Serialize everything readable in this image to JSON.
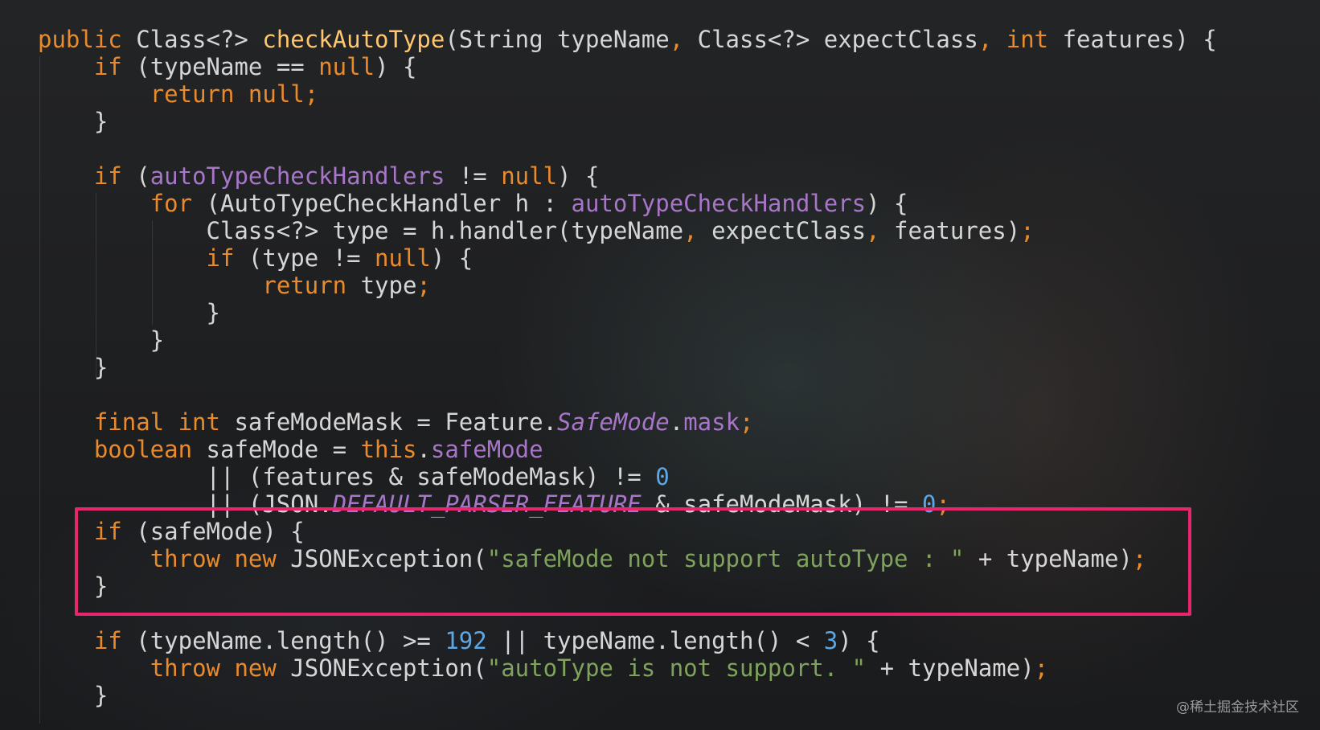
{
  "watermark": "@稀土掘金技术社区",
  "code_lines": [
    [
      {
        "t": "public ",
        "c": "kw"
      },
      {
        "t": "Class<?> ",
        "c": ""
      },
      {
        "t": "checkAutoType",
        "c": "fn"
      },
      {
        "t": "(String typeName",
        "c": ""
      },
      {
        "t": ", ",
        "c": "sep"
      },
      {
        "t": "Class<?> expectClass",
        "c": ""
      },
      {
        "t": ", ",
        "c": "sep"
      },
      {
        "t": "int ",
        "c": "kw"
      },
      {
        "t": "features) {",
        "c": ""
      }
    ],
    [
      {
        "t": "    ",
        "c": ""
      },
      {
        "t": "if ",
        "c": "kw"
      },
      {
        "t": "(typeName == ",
        "c": ""
      },
      {
        "t": "null",
        "c": "kw"
      },
      {
        "t": ") {",
        "c": ""
      }
    ],
    [
      {
        "t": "        ",
        "c": ""
      },
      {
        "t": "return null;",
        "c": "kw"
      }
    ],
    [
      {
        "t": "    }",
        "c": ""
      }
    ],
    [],
    [
      {
        "t": "    ",
        "c": ""
      },
      {
        "t": "if ",
        "c": "kw"
      },
      {
        "t": "(",
        "c": ""
      },
      {
        "t": "autoTypeCheckHandlers",
        "c": "fld"
      },
      {
        "t": " != ",
        "c": ""
      },
      {
        "t": "null",
        "c": "kw"
      },
      {
        "t": ") {",
        "c": ""
      }
    ],
    [
      {
        "t": "        ",
        "c": ""
      },
      {
        "t": "for ",
        "c": "kw"
      },
      {
        "t": "(AutoTypeCheckHandler h : ",
        "c": ""
      },
      {
        "t": "autoTypeCheckHandlers",
        "c": "fld"
      },
      {
        "t": ") {",
        "c": ""
      }
    ],
    [
      {
        "t": "            Class<?> type = h.handler(typeName",
        "c": ""
      },
      {
        "t": ", ",
        "c": "sep"
      },
      {
        "t": "expectClass",
        "c": ""
      },
      {
        "t": ", ",
        "c": "sep"
      },
      {
        "t": "features)",
        "c": ""
      },
      {
        "t": ";",
        "c": "sep"
      }
    ],
    [
      {
        "t": "            ",
        "c": ""
      },
      {
        "t": "if ",
        "c": "kw"
      },
      {
        "t": "(type != ",
        "c": ""
      },
      {
        "t": "null",
        "c": "kw"
      },
      {
        "t": ") {",
        "c": ""
      }
    ],
    [
      {
        "t": "                ",
        "c": ""
      },
      {
        "t": "return ",
        "c": "kw"
      },
      {
        "t": "type",
        "c": ""
      },
      {
        "t": ";",
        "c": "sep"
      }
    ],
    [
      {
        "t": "            }",
        "c": ""
      }
    ],
    [
      {
        "t": "        }",
        "c": ""
      }
    ],
    [
      {
        "t": "    }",
        "c": ""
      }
    ],
    [],
    [
      {
        "t": "    ",
        "c": ""
      },
      {
        "t": "final int ",
        "c": "kw"
      },
      {
        "t": "safeModeMask = Feature.",
        "c": ""
      },
      {
        "t": "SafeMode",
        "c": "ifld"
      },
      {
        "t": ".",
        "c": ""
      },
      {
        "t": "mask",
        "c": "fld"
      },
      {
        "t": ";",
        "c": "sep"
      }
    ],
    [
      {
        "t": "    ",
        "c": ""
      },
      {
        "t": "boolean ",
        "c": "kw"
      },
      {
        "t": "safeMode = ",
        "c": ""
      },
      {
        "t": "this",
        "c": "kw"
      },
      {
        "t": ".",
        "c": ""
      },
      {
        "t": "safeMode",
        "c": "fld"
      }
    ],
    [
      {
        "t": "            || (features & safeModeMask) != ",
        "c": ""
      },
      {
        "t": "0",
        "c": "num"
      }
    ],
    [
      {
        "t": "            || (JSON.",
        "c": ""
      },
      {
        "t": "DEFAULT_PARSER_FEATURE",
        "c": "ifld"
      },
      {
        "t": " & safeModeMask) != ",
        "c": ""
      },
      {
        "t": "0",
        "c": "num"
      },
      {
        "t": ";",
        "c": "sep"
      }
    ],
    [
      {
        "t": "    ",
        "c": ""
      },
      {
        "t": "if ",
        "c": "kw"
      },
      {
        "t": "(safeMode) {",
        "c": ""
      }
    ],
    [
      {
        "t": "        ",
        "c": ""
      },
      {
        "t": "throw new ",
        "c": "kw"
      },
      {
        "t": "JSONException(",
        "c": ""
      },
      {
        "t": "\"safeMode not support autoType : \"",
        "c": "str"
      },
      {
        "t": " + typeName)",
        "c": ""
      },
      {
        "t": ";",
        "c": "sep"
      }
    ],
    [
      {
        "t": "    }",
        "c": ""
      }
    ],
    [],
    [
      {
        "t": "    ",
        "c": ""
      },
      {
        "t": "if ",
        "c": "kw"
      },
      {
        "t": "(typeName.length() >= ",
        "c": ""
      },
      {
        "t": "192",
        "c": "num"
      },
      {
        "t": " || typeName.length() < ",
        "c": ""
      },
      {
        "t": "3",
        "c": "num"
      },
      {
        "t": ") {",
        "c": ""
      }
    ],
    [
      {
        "t": "        ",
        "c": ""
      },
      {
        "t": "throw new ",
        "c": "kw"
      },
      {
        "t": "JSONException(",
        "c": ""
      },
      {
        "t": "\"autoType is not support. \"",
        "c": "str"
      },
      {
        "t": " + typeName)",
        "c": ""
      },
      {
        "t": ";",
        "c": "sep"
      }
    ],
    [
      {
        "t": "    }",
        "c": ""
      }
    ]
  ]
}
